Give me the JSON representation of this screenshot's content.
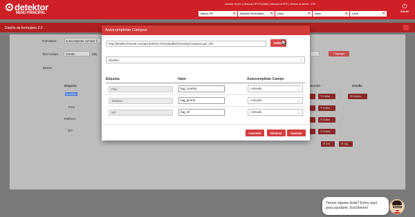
{
  "header": {
    "logo": "detektor",
    "logo_sub": "MENÚ PRINCIPAL",
    "user_line": "Usuario: inyiec | | Manual GPS Portable | Manual en PDF | Versión al cliente : 17/4",
    "tabs": [
      {
        "label": "Nuevo CP"
      },
      {
        "label": "Diseñar Formulario"
      },
      {
        "label": "Libre"
      },
      {
        "label": "Libre"
      },
      {
        "label": "Libre"
      }
    ],
    "exit_label": "SALIR"
  },
  "page": {
    "title": "Diseño de formulario 2.0",
    "form_label": "Formulario:",
    "form_value": "autocompletar cambiar fi",
    "field_type_label": "Tipo Campo:",
    "field_type_value": "Combo",
    "etiq_label": "Etiq",
    "add_button": "+ Agregar",
    "search_label": "Buscar",
    "col_etiqueta": "Etiqueta",
    "col_accion": "Acción",
    "col_detalle": "Detalle",
    "rows": [
      {
        "label": "Nombre",
        "selected": true
      },
      {
        "label": "País",
        "selected": false
      },
      {
        "label": "Teléfono",
        "selected": false
      },
      {
        "label": "NIT",
        "selected": false
      }
    ],
    "edit_label": "Editar",
    "detail_label": "Detalle",
    "prev_label": "Ant",
    "next_label": "Sig"
  },
  "modal": {
    "title": "Autocompletar Campos",
    "url_value": "http://detektor.freevar.com/api-detektor-forms/public/forms/api?request=get_info",
    "validate_button": "Validar",
    "field_select_value": "Nombre",
    "col_etiqueta": "Etiqueta",
    "col_valor": "Valor",
    "col_autocompletar": "Autocompletar Campo",
    "rows": [
      {
        "etiqueta": "País",
        "valor": "tag_country",
        "auto": "Activado"
      },
      {
        "etiqueta": "Teléfono",
        "valor": "tag_phone",
        "auto": "Activado"
      },
      {
        "etiqueta": "NIT",
        "valor": "tag_nit",
        "auto": "Activado"
      }
    ],
    "cancel_button": "Cancelar",
    "delete_button": "Eliminar",
    "save_button": "Guardar"
  },
  "chat": {
    "message": "Tienes alguna duda? Estoy aquí para ayudarte. Escríbeme!"
  },
  "colors": {
    "brand_red": "#cf2027",
    "button_red": "#d94848"
  }
}
